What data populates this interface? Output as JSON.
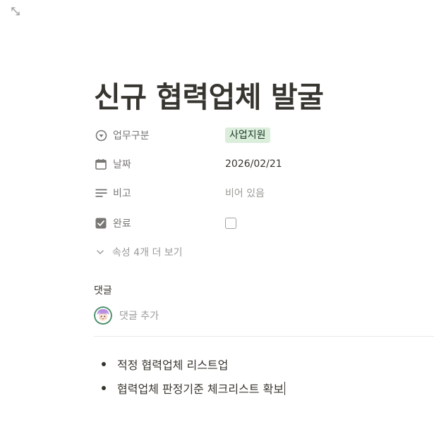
{
  "toolbar": {
    "expand_icon": "expand-diagonal-icon"
  },
  "page": {
    "title": "신규 협력업체 발굴"
  },
  "properties": [
    {
      "icon": "select-icon",
      "name": "업무구분",
      "value": "사업지원",
      "type": "tag",
      "tag_bg": "#dbeddb",
      "tag_color": "#1c3829"
    },
    {
      "icon": "calendar-icon",
      "name": "날짜",
      "value": "2026/02/21",
      "type": "date"
    },
    {
      "icon": "text-lines-icon",
      "name": "비고",
      "value": "비어 있음",
      "type": "empty"
    },
    {
      "icon": "checkbox-icon",
      "name": "완료",
      "value": "",
      "checked": false,
      "type": "checkbox"
    }
  ],
  "more_properties": {
    "label": "속성 4개 더 보기",
    "icon": "chevron-down-icon"
  },
  "comments": {
    "heading": "댓글",
    "placeholder": "댓글 추가",
    "avatar": "user-avatar"
  },
  "content": {
    "bullets": [
      "적정 협력업체 리스트업",
      "협력업체 판정기준 체크리스트 확보"
    ]
  }
}
